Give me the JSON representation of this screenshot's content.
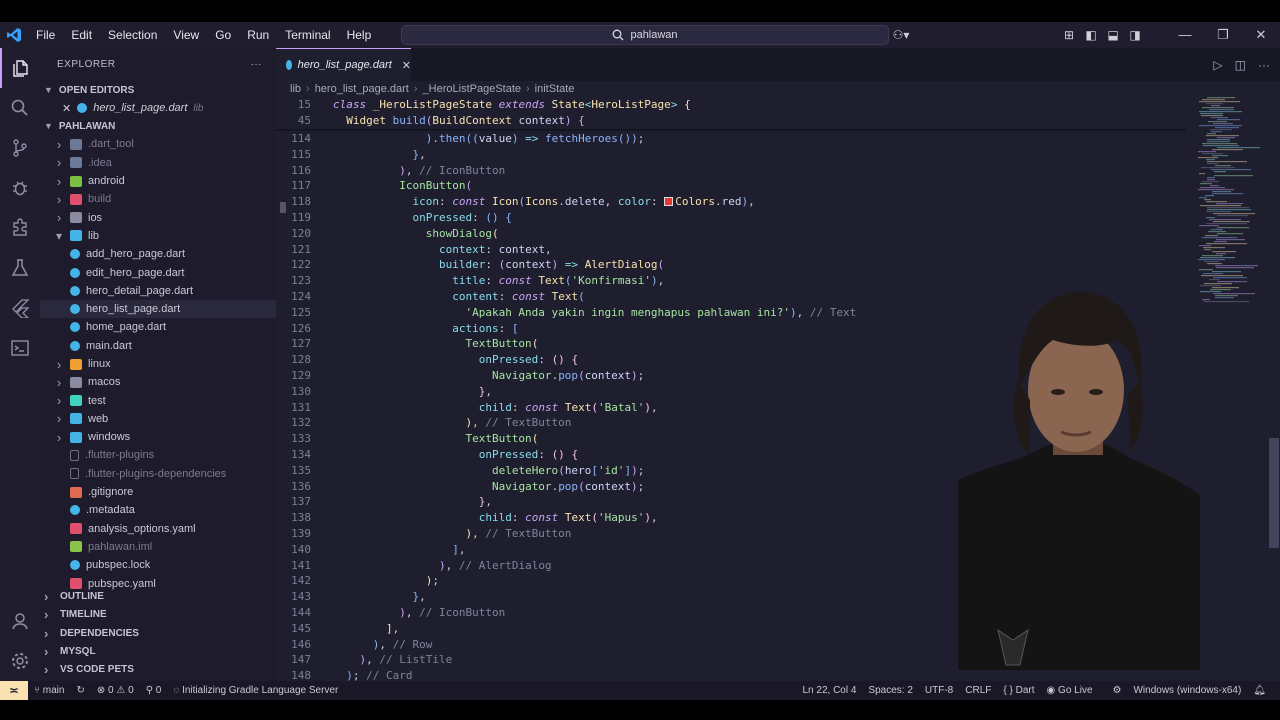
{
  "titlebar": {
    "menu": [
      "File",
      "Edit",
      "Selection",
      "View",
      "Go",
      "Run",
      "Terminal",
      "Help"
    ],
    "search_text": "pahlawan"
  },
  "sidebar": {
    "explorer_label": "EXPLORER",
    "open_editors_label": "OPEN EDITORS",
    "open_editor_file": "hero_list_page.dart",
    "open_editor_folder": "lib",
    "project_label": "PAHLAWAN",
    "tree": [
      {
        "label": ".dart_tool",
        "type": "folder",
        "dim": true
      },
      {
        "label": ".idea",
        "type": "folder",
        "dim": true
      },
      {
        "label": "android",
        "type": "folder"
      },
      {
        "label": "build",
        "type": "folder",
        "dim": true
      },
      {
        "label": "ios",
        "type": "folder"
      },
      {
        "label": "lib",
        "type": "folder-open"
      },
      {
        "label": "add_hero_page.dart",
        "type": "dart",
        "indent": 2
      },
      {
        "label": "edit_hero_page.dart",
        "type": "dart",
        "indent": 2
      },
      {
        "label": "hero_detail_page.dart",
        "type": "dart",
        "indent": 2
      },
      {
        "label": "hero_list_page.dart",
        "type": "dart",
        "indent": 2,
        "selected": true
      },
      {
        "label": "home_page.dart",
        "type": "dart",
        "indent": 2
      },
      {
        "label": "main.dart",
        "type": "dart",
        "indent": 2
      },
      {
        "label": "linux",
        "type": "folder"
      },
      {
        "label": "macos",
        "type": "folder"
      },
      {
        "label": "test",
        "type": "folder"
      },
      {
        "label": "web",
        "type": "folder"
      },
      {
        "label": "windows",
        "type": "folder"
      },
      {
        "label": ".flutter-plugins",
        "type": "file",
        "dim": true
      },
      {
        "label": ".flutter-plugins-dependencies",
        "type": "file",
        "dim": true
      },
      {
        "label": ".gitignore",
        "type": "git"
      },
      {
        "label": ".metadata",
        "type": "meta"
      },
      {
        "label": "analysis_options.yaml",
        "type": "yaml"
      },
      {
        "label": "pahlawan.iml",
        "type": "iml",
        "dim": true
      },
      {
        "label": "pubspec.lock",
        "type": "lock"
      },
      {
        "label": "pubspec.yaml",
        "type": "yaml"
      }
    ],
    "sections": [
      "OUTLINE",
      "TIMELINE",
      "DEPENDENCIES",
      "MYSQL",
      "VS CODE PETS"
    ]
  },
  "editor": {
    "tab_label": "hero_list_page.dart",
    "breadcrumb": [
      "lib",
      "hero_list_page.dart",
      "_HeroListPageState",
      "initState"
    ],
    "sticky": [
      {
        "num": "15",
        "html": "<span class='k'>class</span> <span class='t'>_HeroListPageState</span> <span class='k'>extends</span> <span class='t'>State</span><span class='o'>&lt;</span><span class='t'>HeroListPage</span><span class='o'>&gt;</span> <span class='y'>{</span>"
      },
      {
        "num": "45",
        "html": "  <span class='t'>Widget</span> <span class='f'>build</span><span class='q'>(</span><span class='t'>BuildContext</span> <span class='n'>context</span><span class='q'>)</span> <span class='q'>{</span>"
      }
    ],
    "lines": [
      {
        "num": "114",
        "html": "              <span class='b'>)</span>.<span class='f'>then</span><span class='b'>((</span><span class='n'>value</span><span class='b'>)</span> <span class='o'>=&gt;</span> <span class='f'>fetchHeroes</span><span class='b'>())</span>;"
      },
      {
        "num": "115",
        "html": "            <span class='b'>}</span>,"
      },
      {
        "num": "116",
        "html": "          <span class='q'>)</span>, <span class='c'>// IconButton</span>"
      },
      {
        "num": "117",
        "html": "          <span class='s'>IconButton</span><span class='q'>(</span>"
      },
      {
        "num": "118",
        "html": "            <span class='pr'>icon</span>: <span class='k'>const</span> <span class='t'>Icon</span><span class='b'>(</span><span class='t'>Icons</span>.<span class='n'>delete</span>, <span class='pr'>color</span>: <span class='swatch'></span><span class='t'>Colors</span>.<span class='n'>red</span><span class='b'>)</span>,"
      },
      {
        "num": "119",
        "html": "            <span class='pr'>onPressed</span>: <span class='b'>()</span> <span class='b'>{</span>"
      },
      {
        "num": "120",
        "html": "              <span class='s'>showDialog</span><span class='y'>(</span>"
      },
      {
        "num": "121",
        "html": "                <span class='pr'>context</span>: <span class='n'>context</span>,"
      },
      {
        "num": "122",
        "html": "                <span class='pr'>builder</span>: <span class='q'>(</span><span class='n'>context</span><span class='q'>)</span> <span class='o'>=&gt;</span> <span class='t'>AlertDialog</span><span class='q'>(</span>"
      },
      {
        "num": "123",
        "html": "                  <span class='pr'>title</span>: <span class='k'>const</span> <span class='t'>Text</span><span class='b'>(</span><span class='s'>'Konfirmasi'</span><span class='b'>)</span>,"
      },
      {
        "num": "124",
        "html": "                  <span class='pr'>content</span>: <span class='k'>const</span> <span class='t'>Text</span><span class='b'>(</span>"
      },
      {
        "num": "125",
        "html": "                    <span class='s'>'Apakah Anda yakin ingin menghapus pahlawan ini?'</span><span class='b'>)</span>, <span class='c'>// Text</span>"
      },
      {
        "num": "126",
        "html": "                  <span class='pr'>actions</span>: <span class='b'>[</span>"
      },
      {
        "num": "127",
        "html": "                    <span class='s'>TextButton</span><span class='y'>(</span>"
      },
      {
        "num": "128",
        "html": "                      <span class='pr'>onPressed</span>: <span class='p'>()</span> <span class='p'>{</span>"
      },
      {
        "num": "129",
        "html": "                        <span class='s'>Navigator</span>.<span class='f'>pop</span><span class='q'>(</span><span class='n'>context</span><span class='q'>)</span>;"
      },
      {
        "num": "130",
        "html": "                      <span class='p'>}</span>,"
      },
      {
        "num": "131",
        "html": "                      <span class='pr'>child</span>: <span class='k'>const</span> <span class='t'>Text</span><span class='p'>(</span><span class='s'>'Batal'</span><span class='p'>)</span>,"
      },
      {
        "num": "132",
        "html": "                    <span class='y'>)</span>, <span class='c'>// TextButton</span>"
      },
      {
        "num": "133",
        "html": "                    <span class='s'>TextButton</span><span class='y'>(</span>"
      },
      {
        "num": "134",
        "html": "                      <span class='pr'>onPressed</span>: <span class='p'>()</span> <span class='p'>{</span>"
      },
      {
        "num": "135",
        "html": "                        <span class='s'>deleteHero</span><span class='q'>(</span><span class='n'>hero</span><span class='b'>[</span><span class='s'>'id'</span><span class='b'>]</span><span class='q'>)</span>;"
      },
      {
        "num": "136",
        "html": "                        <span class='s'>Navigator</span>.<span class='f'>pop</span><span class='q'>(</span><span class='n'>context</span><span class='q'>)</span>;"
      },
      {
        "num": "137",
        "html": "                      <span class='p'>}</span>,"
      },
      {
        "num": "138",
        "html": "                      <span class='pr'>child</span>: <span class='k'>const</span> <span class='t'>Text</span><span class='p'>(</span><span class='s'>'Hapus'</span><span class='p'>)</span>,"
      },
      {
        "num": "139",
        "html": "                    <span class='y'>)</span>, <span class='c'>// TextButton</span>"
      },
      {
        "num": "140",
        "html": "                  <span class='b'>]</span>,"
      },
      {
        "num": "141",
        "html": "                <span class='q'>)</span>, <span class='c'>// AlertDialog</span>"
      },
      {
        "num": "142",
        "html": "              <span class='y'>)</span>;"
      },
      {
        "num": "143",
        "html": "            <span class='b'>}</span>,"
      },
      {
        "num": "144",
        "html": "          <span class='q'>)</span>, <span class='c'>// IconButton</span>"
      },
      {
        "num": "145",
        "html": "        <span class='y'>]</span>,"
      },
      {
        "num": "146",
        "html": "      <span class='b'>)</span>, <span class='c'>// Row</span>"
      },
      {
        "num": "147",
        "html": "    <span class='q'>)</span>, <span class='c'>// ListTile</span>"
      },
      {
        "num": "148",
        "html": "  <span class='b'>)</span>; <span class='c'>// Card</span>"
      }
    ]
  },
  "statusbar": {
    "branch": "main",
    "errors": "0",
    "warnings": "0",
    "ports": "0",
    "task": "Initializing Gradle Language Server",
    "cursor": "Ln 22, Col 4",
    "spaces": "Spaces: 2",
    "encoding": "UTF-8",
    "eol": "CRLF",
    "language": "Dart",
    "golive": "Go Live",
    "device": "Windows (windows-x64)"
  }
}
